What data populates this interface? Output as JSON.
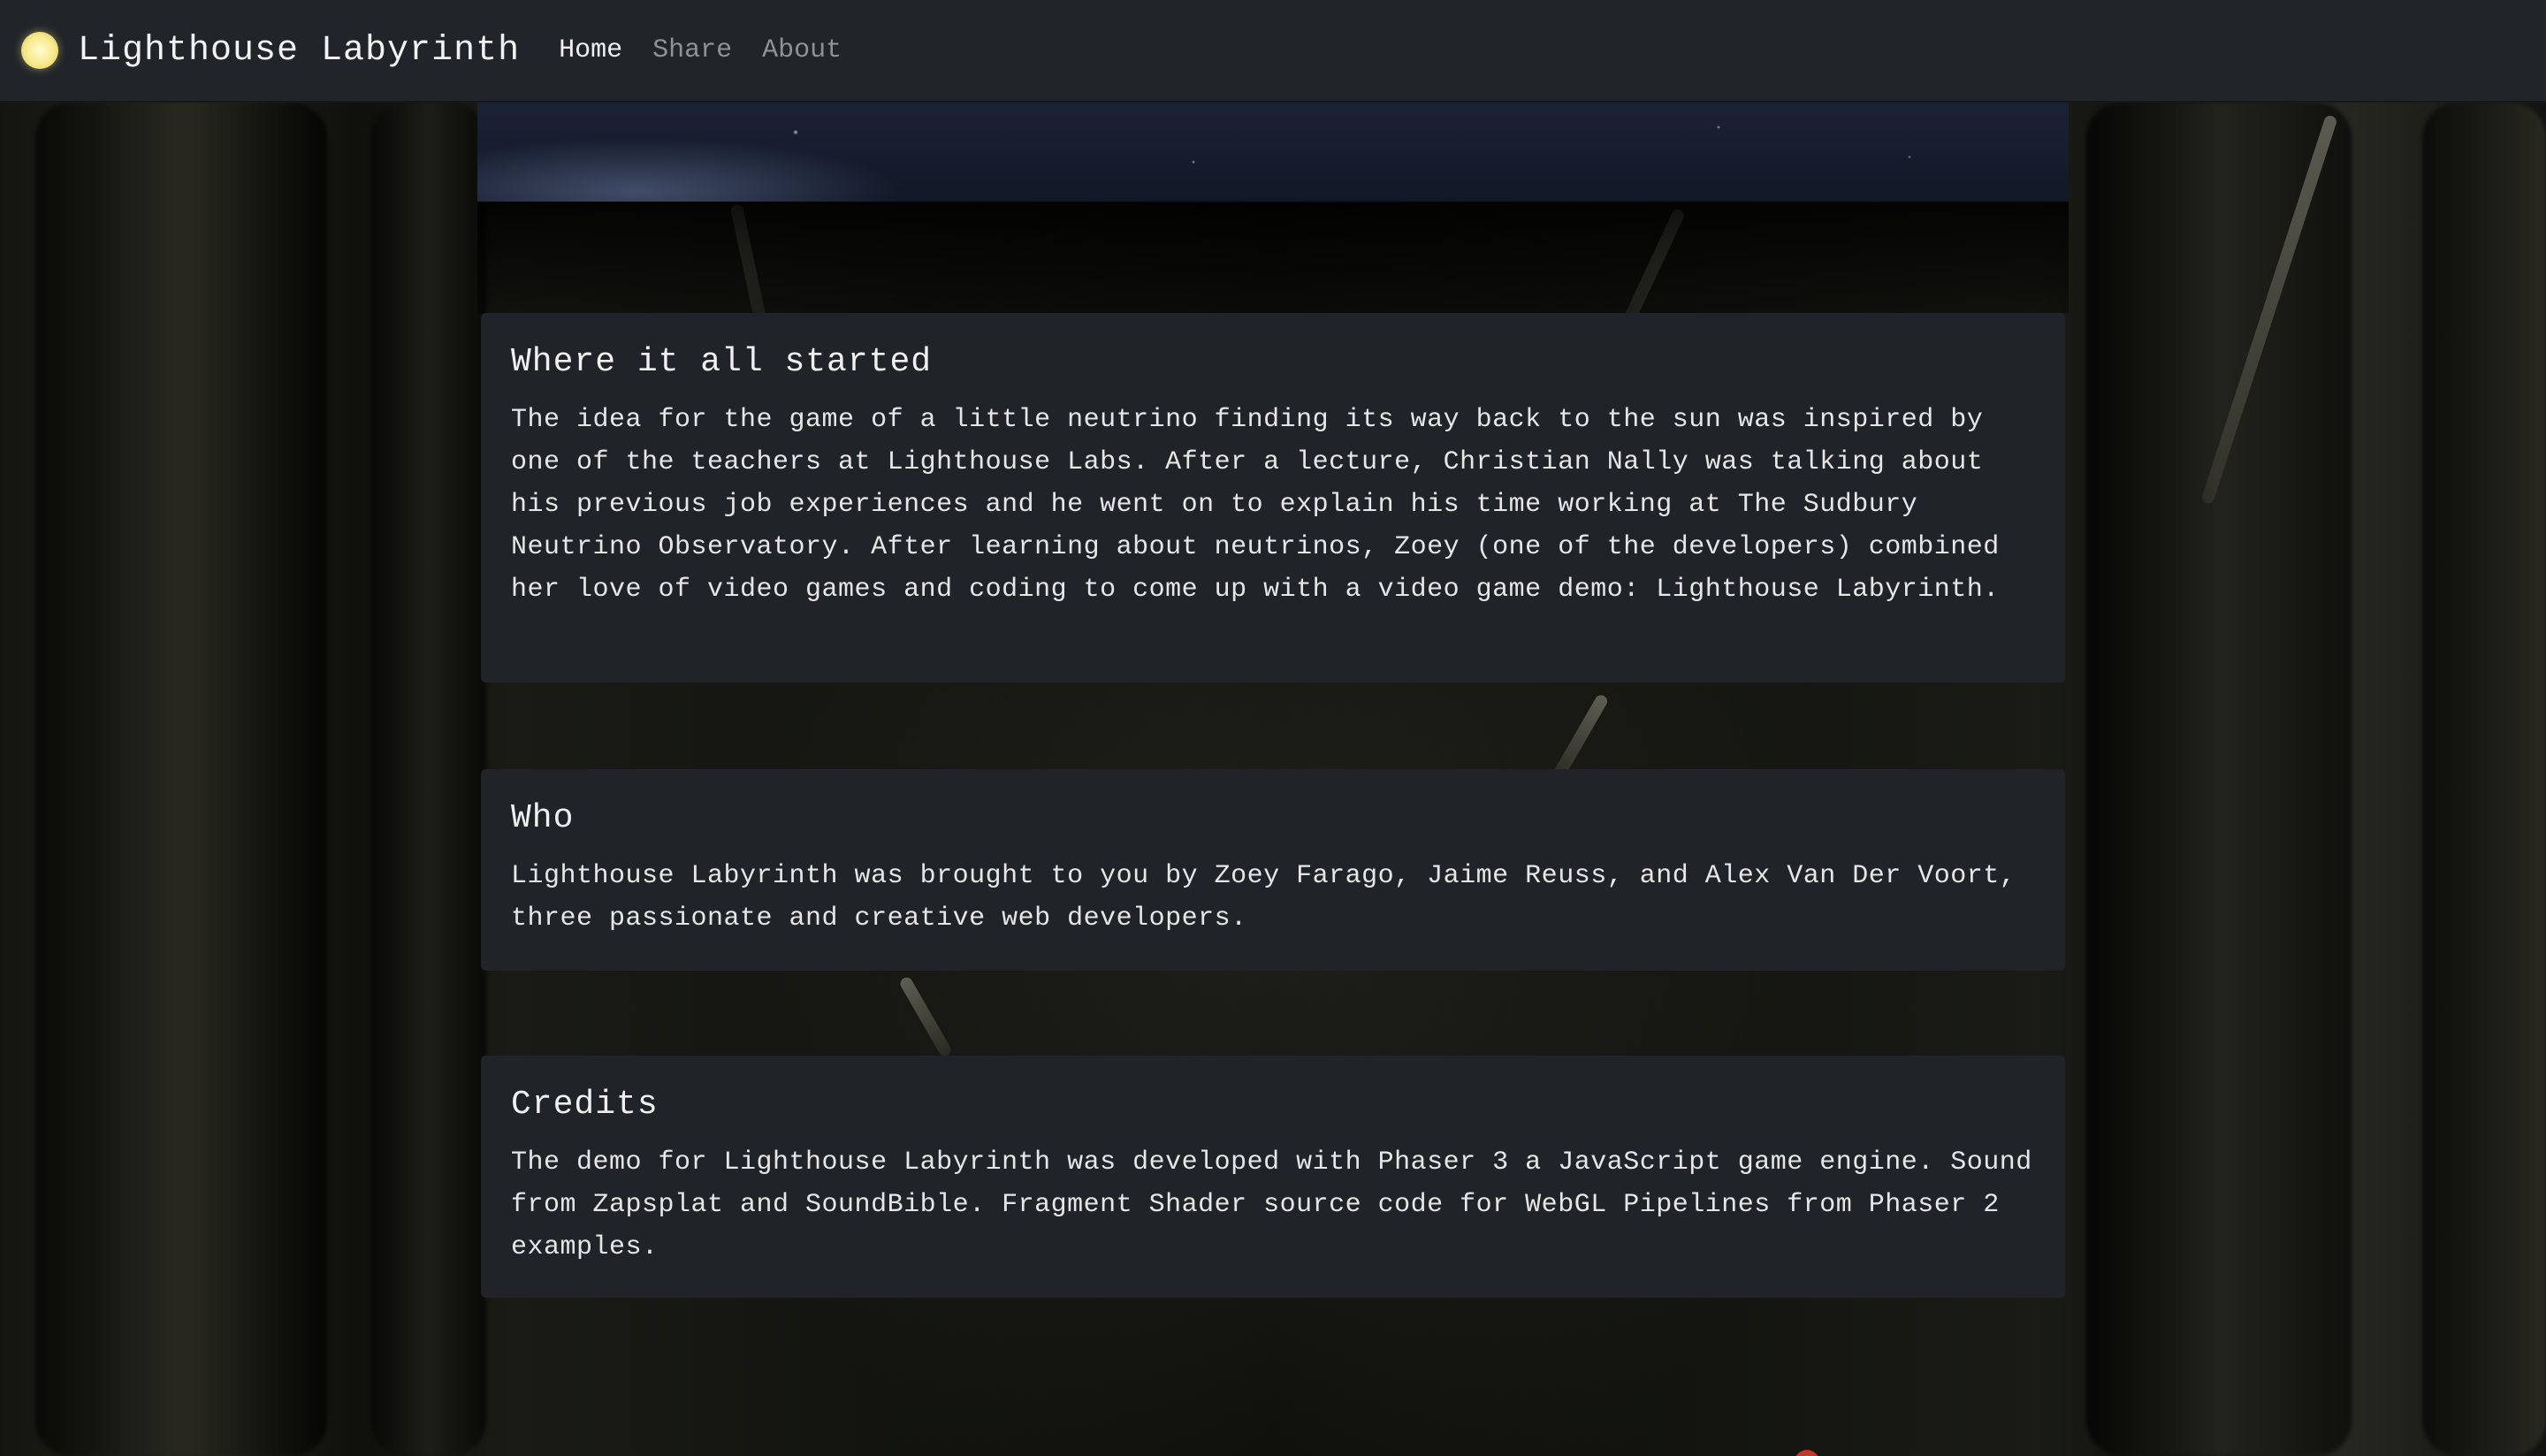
{
  "navbar": {
    "brand_title": "Lighthouse Labyrinth",
    "brand_icon": "sun-icon",
    "links": [
      {
        "label": "Home",
        "active": true
      },
      {
        "label": "Share",
        "active": false
      },
      {
        "label": "About",
        "active": false
      }
    ]
  },
  "sections": [
    {
      "heading": "Where it all started",
      "body": "The idea for the game of a little neutrino finding its way back to the sun was inspired by one of the teachers at Lighthouse Labs. After a lecture, Christian Nally was talking about his previous job experiences and he went on to explain his time working at The Sudbury Neutrino Observatory. After learning about neutrinos, Zoey (one of the developers) combined her love of video games and coding to come up with a video game demo: Lighthouse Labyrinth."
    },
    {
      "heading": "Who",
      "body": "Lighthouse Labyrinth was brought to you by Zoey Farago, Jaime Reuss, and Alex Van Der Voort, three passionate and creative web developers."
    },
    {
      "heading": "Credits",
      "body": "The demo for Lighthouse Labyrinth was developed with Phaser 3 a JavaScript game engine. Sound from Zapsplat and SoundBible. Fragment Shader source code for WebGL Pipelines from Phaser 2 examples."
    }
  ],
  "colors": {
    "navbar_bg": "#212429",
    "card_bg": "#202328",
    "text": "#e6e6e6",
    "nav_inactive": "#8e9196",
    "sun": "#f7e98a"
  }
}
